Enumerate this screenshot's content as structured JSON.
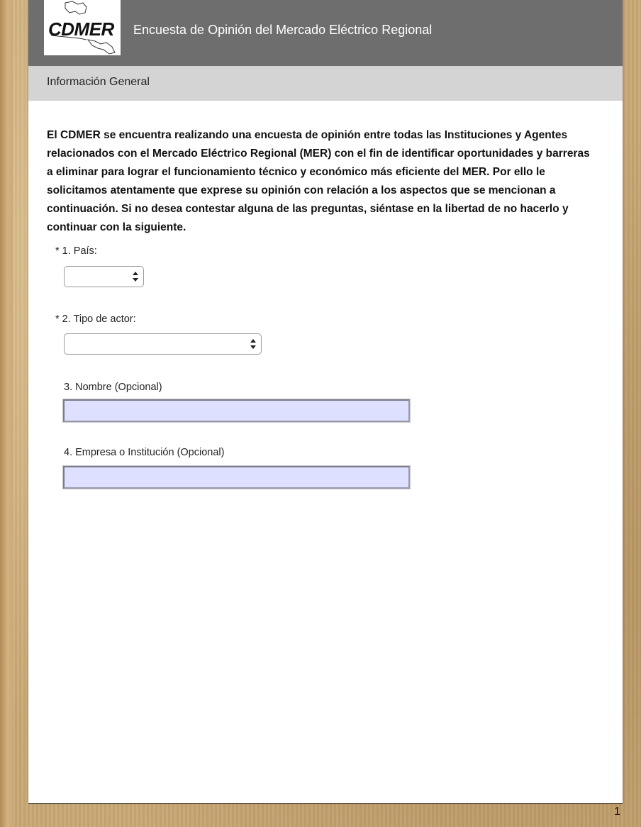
{
  "header": {
    "logo_text": "CDMER",
    "title": "Encuesta de Opinión del Mercado Eléctrico Regional"
  },
  "section": {
    "title": "Información General"
  },
  "intro": "El CDMER se encuentra realizando una encuesta de opinión entre todas las Instituciones y Agentes relacionados con el Mercado Eléctrico Regional (MER) con el fin de identificar oportunidades y barreras a eliminar para lograr el funcionamiento técnico y económico más eficiente del MER. Por ello le solicitamos atentamente que exprese su opinión con relación a los aspectos que se mencionan a continuación. Si no desea contestar alguna de las preguntas, siéntase en la libertad de no hacerlo y continuar con la siguiente.",
  "questions": [
    {
      "label": "* 1. País:",
      "type": "select",
      "value": ""
    },
    {
      "label": "* 2. Tipo de actor:",
      "type": "select",
      "value": ""
    },
    {
      "label": "3. Nombre (Opcional)",
      "type": "text",
      "value": ""
    },
    {
      "label": "4. Empresa o Institución (Opcional)",
      "type": "text",
      "value": ""
    }
  ],
  "footer": {
    "page_number": "1"
  },
  "colors": {
    "header_bg": "#6e6e6e",
    "section_bg": "#d4d4d4",
    "input_bg": "#dde1ff"
  }
}
